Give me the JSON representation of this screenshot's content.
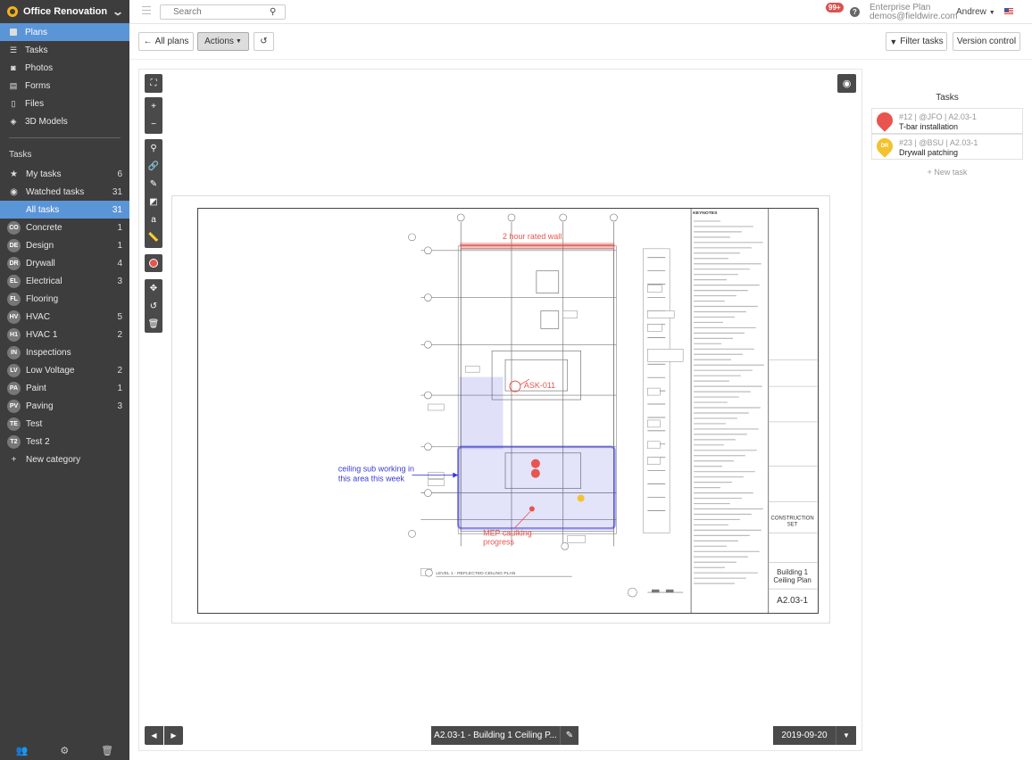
{
  "project": {
    "name": "Office Renovation"
  },
  "nav": [
    {
      "label": "Plans",
      "icon": "plans-icon"
    },
    {
      "label": "Tasks",
      "icon": "tasks-icon"
    },
    {
      "label": "Photos",
      "icon": "camera-icon"
    },
    {
      "label": "Forms",
      "icon": "forms-icon"
    },
    {
      "label": "Files",
      "icon": "files-icon"
    },
    {
      "label": "3D Models",
      "icon": "cube-icon"
    }
  ],
  "tasks_heading": "Tasks",
  "task_filters": [
    {
      "label": "My tasks",
      "count": "6"
    },
    {
      "label": "Watched tasks",
      "count": "31"
    },
    {
      "label": "All tasks",
      "count": "31"
    }
  ],
  "categories": [
    {
      "abbr": "CO",
      "label": "Concrete",
      "count": "1"
    },
    {
      "abbr": "DE",
      "label": "Design",
      "count": "1"
    },
    {
      "abbr": "DR",
      "label": "Drywall",
      "count": "4"
    },
    {
      "abbr": "EL",
      "label": "Electrical",
      "count": "3"
    },
    {
      "abbr": "FL",
      "label": "Flooring",
      "count": ""
    },
    {
      "abbr": "HV",
      "label": "HVAC",
      "count": "5"
    },
    {
      "abbr": "H1",
      "label": "HVAC 1",
      "count": "2"
    },
    {
      "abbr": "IN",
      "label": "Inspections",
      "count": ""
    },
    {
      "abbr": "LV",
      "label": "Low Voltage",
      "count": "2"
    },
    {
      "abbr": "PA",
      "label": "Paint",
      "count": "1"
    },
    {
      "abbr": "PV",
      "label": "Paving",
      "count": "3"
    },
    {
      "abbr": "TE",
      "label": "Test",
      "count": ""
    },
    {
      "abbr": "T2",
      "label": "Test 2",
      "count": ""
    }
  ],
  "new_category": "New category",
  "topbar": {
    "search_placeholder": "Search",
    "notifications": "99+",
    "plan_name": "Enterprise Plan",
    "email": "demos@fieldwire.com",
    "user": "Andrew"
  },
  "toolbar": {
    "all_plans": "All plans",
    "actions": "Actions",
    "filter_tasks": "Filter tasks",
    "version_control": "Version control"
  },
  "drawing": {
    "annotation_wall": "2 hour rated wall",
    "annotation_ask": "ASK-011",
    "annotation_ceiling_1": "ceiling sub working in",
    "annotation_ceiling_2": "this area this week",
    "annotation_mep_1": "MEP caulking",
    "annotation_mep_2": "progress",
    "keynotes_title": "KEYNOTES",
    "plan_title": "LEVEL 1 - REFLECTED CEILING PLAN",
    "construction_1": "CONSTRUCTION",
    "construction_2": "SET",
    "sheet_title_1": "Building 1",
    "sheet_title_2": "Ceiling Plan",
    "sheet_number": "A2.03-1"
  },
  "bottombar": {
    "sheet": "A2.03-1 - Building 1 Ceiling P...",
    "date": "2019-09-20"
  },
  "tasks_panel": {
    "title": "Tasks",
    "items": [
      {
        "meta": "#12 | @JFO | A2.03-1",
        "title": "T-bar installation",
        "color": "#e8554e",
        "badge": ""
      },
      {
        "meta": "#23 | @BSU | A2.03-1",
        "title": "Drywall patching",
        "color": "#f2c32e",
        "badge": "DR"
      }
    ],
    "new_task": "+ New task"
  },
  "colors": {
    "accent": "#5a95d8",
    "sidebar": "#3d3d3d",
    "markup_red": "#e8554e",
    "markup_blue": "#3a3ad8"
  }
}
